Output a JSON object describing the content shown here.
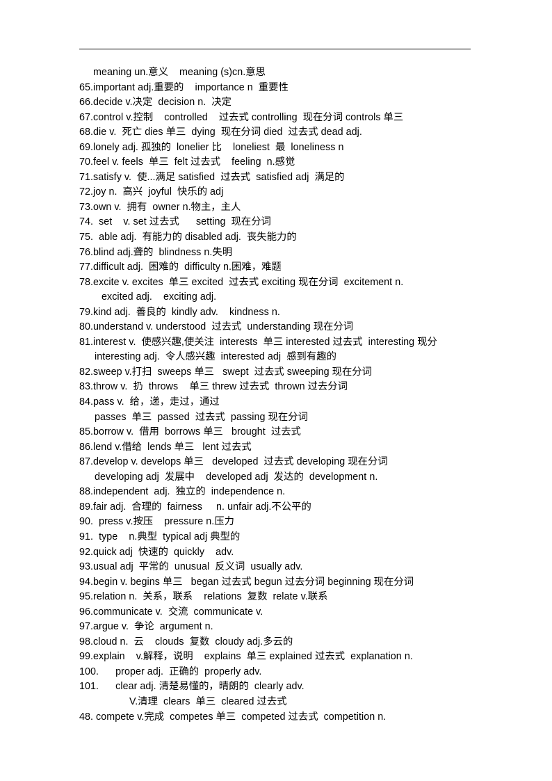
{
  "document": {
    "type": "vocabulary-word-list",
    "language_pair": "English-Chinese",
    "background_color": "#ffffff",
    "text_color": "#000000",
    "header_rule": true,
    "lines": [
      {
        "indent": "a",
        "text": "meaning un.意义    meaning (s)cn.意思"
      },
      {
        "indent": "0",
        "text": "65.important adj.重要的    importance n  重要性"
      },
      {
        "indent": "0",
        "text": "66.decide v.决定  decision n.  决定"
      },
      {
        "indent": "0",
        "text": "67.control v.控制    controlled    过去式 controlling  现在分词 controls 单三"
      },
      {
        "indent": "0",
        "text": "68.die v.  死亡 dies 单三  dying  现在分词 died  过去式 dead adj."
      },
      {
        "indent": "0",
        "text": "69.lonely adj. 孤独的  lonelier 比    loneliest  最  loneliness n"
      },
      {
        "indent": "0",
        "text": "70.feel v. feels  单三  felt 过去式    feeling  n.感觉"
      },
      {
        "indent": "0",
        "text": "71.satisfy v.  使...满足 satisfied  过去式  satisfied adj  满足的"
      },
      {
        "indent": "0",
        "text": "72.joy n.  高兴  joyful  快乐的 adj"
      },
      {
        "indent": "0",
        "text": "73.own v.  拥有  owner n.物主，主人"
      },
      {
        "indent": "0",
        "text": "74.  set    v. set 过去式      setting  现在分词"
      },
      {
        "indent": "0",
        "text": "75.  able adj.  有能力的 disabled adj.  丧失能力的"
      },
      {
        "indent": "0",
        "text": "76.blind adj.聋的  blindness n.失明"
      },
      {
        "indent": "0",
        "text": "77.difficult adj.  困难的  difficulty n.困难，难题"
      },
      {
        "indent": "0",
        "text": "78.excite v. excites  单三 excited  过去式 exciting 现在分词  excitement n."
      },
      {
        "indent": "c",
        "text": "excited adj.    exciting adj."
      },
      {
        "indent": "0",
        "text": "79.kind adj.  善良的  kindly adv.    kindness n."
      },
      {
        "indent": "0",
        "text": "80.understand v. understood  过去式  understanding 现在分词"
      },
      {
        "indent": "0",
        "text": "81.interest v.  使感兴趣,使关注  interests  单三 interested 过去式  interesting 现分"
      },
      {
        "indent": "b",
        "text": "interesting adj.  令人感兴趣  interested adj  感到有趣的"
      },
      {
        "indent": "0",
        "text": "82.sweep v.打扫  sweeps 单三   swept  过去式 sweeping 现在分词"
      },
      {
        "indent": "0",
        "text": "83.throw v.  扔  throws    单三 threw 过去式  thrown 过去分词"
      },
      {
        "indent": "0",
        "text": "84.pass v.  给，递，走过，通过"
      },
      {
        "indent": "b",
        "text": "passes  单三  passed  过去式  passing 现在分词"
      },
      {
        "indent": "0",
        "text": "85.borrow v.  借用  borrows 单三   brought  过去式"
      },
      {
        "indent": "0",
        "text": "86.lend v.借给  lends 单三   lent 过去式"
      },
      {
        "indent": "0",
        "text": "87.develop v. develops 单三   developed  过去式 developing 现在分词"
      },
      {
        "indent": "b",
        "text": "developing adj  发展中    developed adj  发达的  development n."
      },
      {
        "indent": "0",
        "text": "88.independent  adj.  独立的  independence n."
      },
      {
        "indent": "0",
        "text": "89.fair adj.  合理的  fairness     n. unfair adj.不公平的"
      },
      {
        "indent": "0",
        "text": "90.  press v.按压    pressure n.压力"
      },
      {
        "indent": "0",
        "text": "91.  type    n.典型  typical adj 典型的"
      },
      {
        "indent": "0",
        "text": "92.quick adj  快速的  quickly    adv."
      },
      {
        "indent": "0",
        "text": "93.usual adj  平常的  unusual  反义词  usually adv."
      },
      {
        "indent": "0",
        "text": "94.begin v. begins 单三   began 过去式 begun 过去分词 beginning 现在分词"
      },
      {
        "indent": "0",
        "text": "95.relation n.  关系，联系    relations  复数  relate v.联系"
      },
      {
        "indent": "0",
        "text": "96.communicate v.  交流  communicate v."
      },
      {
        "indent": "0",
        "text": "97.argue v.  争论  argument n."
      },
      {
        "indent": "0",
        "text": "98.cloud n.  云    clouds  复数  cloudy adj.多云的"
      },
      {
        "indent": "0",
        "text": "99.explain    v.解释，说明    explains  单三 explained 过去式  explanation n."
      },
      {
        "indent": "0",
        "text": "100.      proper adj.  正确的  properly adv."
      },
      {
        "indent": "0",
        "text": "101.      clear adj. 清楚易懂的，晴朗的  clearly adv."
      },
      {
        "indent": "d",
        "text": "V.清理  clears  单三  cleared 过去式"
      },
      {
        "indent": "0",
        "text": "48. compete v.完成  competes 单三  competed 过去式  competition n."
      }
    ]
  }
}
